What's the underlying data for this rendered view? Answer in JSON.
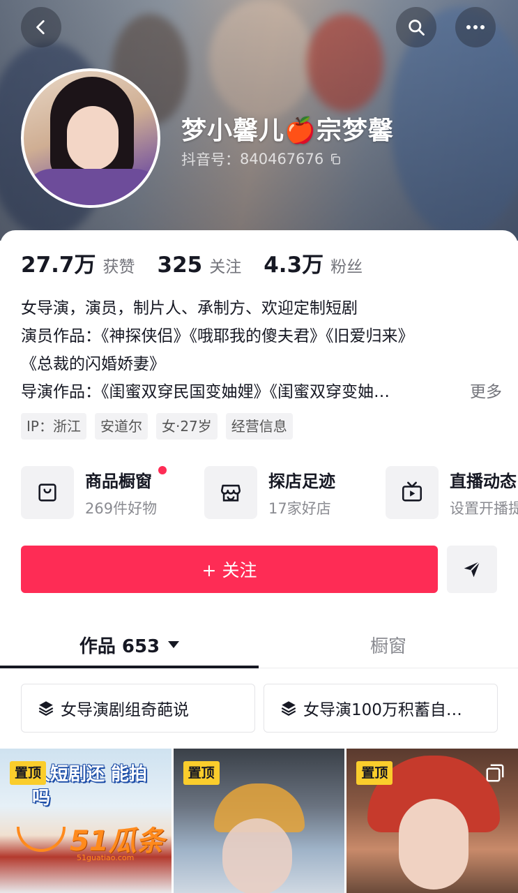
{
  "header": {
    "name": "梦小馨儿🍎宗梦馨",
    "douyin_id_label": "抖音号：",
    "douyin_id": "840467676"
  },
  "stats": [
    {
      "num": "27.7万",
      "label": "获赞"
    },
    {
      "num": "325",
      "label": "关注"
    },
    {
      "num": "4.3万",
      "label": "粉丝"
    }
  ],
  "bio": {
    "line1": "女导演，演员，制片人、承制方、欢迎定制短剧",
    "line2": "演员作品：《神探侠侣》《哦耶我的傻夫君》《旧爱归来》",
    "line3": "《总裁的闪婚娇妻》",
    "line4": "导演作品：《闺蜜双穿民国变妯娌》《闺蜜双穿变妯…",
    "more": "更多"
  },
  "tags": [
    "IP：浙江",
    "安道尔",
    "女·27岁",
    "经营信息"
  ],
  "services": [
    {
      "title": "商品橱窗",
      "subtitle": "269件好物",
      "icon": "bag-icon"
    },
    {
      "title": "探店足迹",
      "subtitle": "17家好店",
      "icon": "store-icon"
    },
    {
      "title": "直播动态",
      "subtitle": "设置开播提醒",
      "icon": "tv-icon"
    }
  ],
  "actions": {
    "follow_label": "+ 关注"
  },
  "tabs": {
    "works_label": "作品 653",
    "showcase_label": "橱窗"
  },
  "collections": [
    {
      "label": "女导演剧组奇葩说",
      "icon": "layers-icon"
    },
    {
      "label": "女导演100万积蓄自…",
      "icon": "layers-icon"
    }
  ],
  "videos": [
    {
      "pinned_label": "置顶",
      "title": "人短剧还 能拍吗",
      "watermark": "51瓜条",
      "watermark_sub": "51guatiao.com"
    },
    {
      "pinned_label": "置顶"
    },
    {
      "pinned_label": "置顶"
    }
  ],
  "colors": {
    "accent": "#fe2c55",
    "pin_badge": "#facd2c"
  }
}
